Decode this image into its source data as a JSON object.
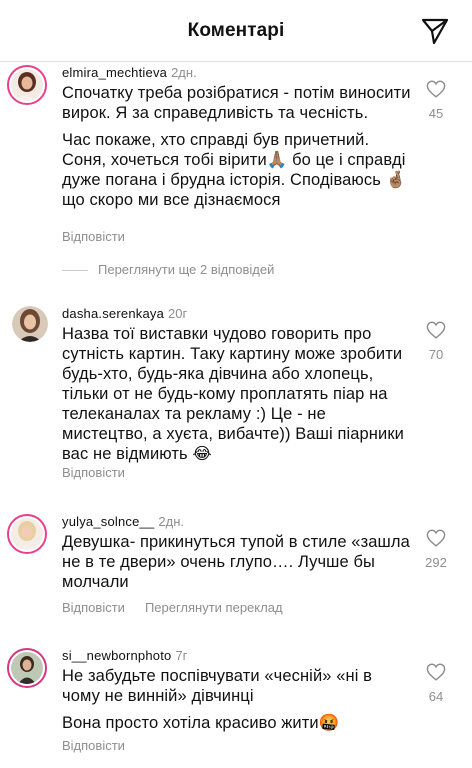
{
  "header": {
    "title": "Коментарі",
    "send_icon": "send-icon"
  },
  "comments": [
    {
      "username": "elmira_mechtieva",
      "time": "2дн.",
      "paragraphs": [
        "Спочатку треба розібратися - потім виносити вирок. Я за справедливість та чесність.",
        "Час покаже, хто справді був причетний. Соня, хочеться тобі вірити🙏🏽 бо це і справді дуже погана і брудна  історія. Сподіваюсь 🤞🏽 що скоро ми все дізнаємося"
      ],
      "likes": "45",
      "reply_label": "Відповісти",
      "view_replies": "Переглянути ще 2 відповідей"
    },
    {
      "username": "dasha.serenkaya",
      "time": "20г",
      "paragraphs": [
        "Назва тої виставки чудово говорить про сутність картин. Таку картину може зробити будь-хто, будь-яка дівчина або хлопець, тільки от не будь-кому проплатять піар на телеканалах та рекламу :) Це - не мистецтво, а хуєта, вибачте)) Ваші піарники вас не відмиють 😂"
      ],
      "likes": "70",
      "reply_label": "Відповісти"
    },
    {
      "username": "yulya_solnce__",
      "time": "2дн.",
      "paragraphs": [
        "Девушка- прикинуться тупой в стиле «зашла не в те двери» очень глупо…. Лучше бы молчали"
      ],
      "likes": "292",
      "reply_label": "Відповісти",
      "translate_label": "Переглянути переклад"
    },
    {
      "username": "si__newbornphoto",
      "time": "7г",
      "paragraphs": [
        "Не забудьте поспівчувати «чесній» «ні в чому не винній» дівчинці",
        "Вона просто хотіла красиво жити🤬"
      ],
      "likes": "64",
      "reply_label": "Відповісти"
    }
  ]
}
